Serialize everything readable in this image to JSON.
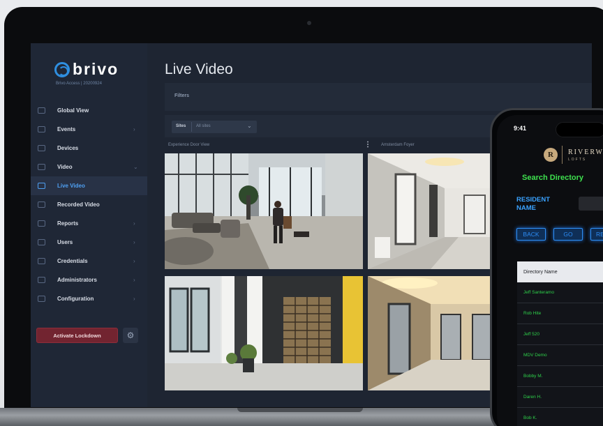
{
  "app": {
    "brand": "brivo",
    "version_text": "Brivo Access  |  20200924",
    "page_title": "Live Video"
  },
  "sidebar": {
    "items": [
      {
        "label": "Global View",
        "icon": "globe-icon",
        "chevron": false,
        "active": false
      },
      {
        "label": "Events",
        "icon": "chat-icon",
        "chevron": true,
        "active": false
      },
      {
        "label": "Devices",
        "icon": "device-grid-icon",
        "chevron": false,
        "active": false
      },
      {
        "label": "Video",
        "icon": "video-camera-icon",
        "chevron": true,
        "active": false
      },
      {
        "label": "Live Video",
        "icon": "live-video-icon",
        "chevron": false,
        "active": true
      },
      {
        "label": "Recorded Video",
        "icon": "recorded-video-icon",
        "chevron": false,
        "active": false
      },
      {
        "label": "Reports",
        "icon": "report-icon",
        "chevron": true,
        "active": false
      },
      {
        "label": "Users",
        "icon": "user-icon",
        "chevron": true,
        "active": false
      },
      {
        "label": "Credentials",
        "icon": "credential-icon",
        "chevron": true,
        "active": false
      },
      {
        "label": "Administrators",
        "icon": "admin-icon",
        "chevron": true,
        "active": false
      },
      {
        "label": "Configuration",
        "icon": "briefcase-icon",
        "chevron": true,
        "active": false
      }
    ],
    "lockdown_label": "Activate Lockdown",
    "settings_icon": "gear-icon"
  },
  "filters": {
    "label": "Filters",
    "sites_key": "Sites",
    "sites_value": "All sites"
  },
  "cameras": [
    {
      "title": "Experience Door View"
    },
    {
      "title": "Amsterdam Foyer"
    },
    {
      "title": ""
    },
    {
      "title": ""
    }
  ],
  "phone": {
    "time": "9:41",
    "logo_letter": "R",
    "brand": "RIVERWA",
    "brand_sub": "LOFTS",
    "search_title": "Search Directory",
    "resident_label": "RESIDENT NAME",
    "buttons": {
      "back": "BACK",
      "go": "GO",
      "reset": "RE"
    },
    "table_header": "Directory Name",
    "directory": [
      "Jeff Santeramo",
      "Rob Hite",
      "Jeff 520",
      "MDV Demo",
      "Bobby M.",
      "Daren H.",
      "Bob K."
    ]
  },
  "colors": {
    "accent_blue": "#4fa0f2",
    "lockdown_red": "#722430",
    "phone_green": "#3ee04e",
    "phone_blue": "#2e8ff5"
  }
}
